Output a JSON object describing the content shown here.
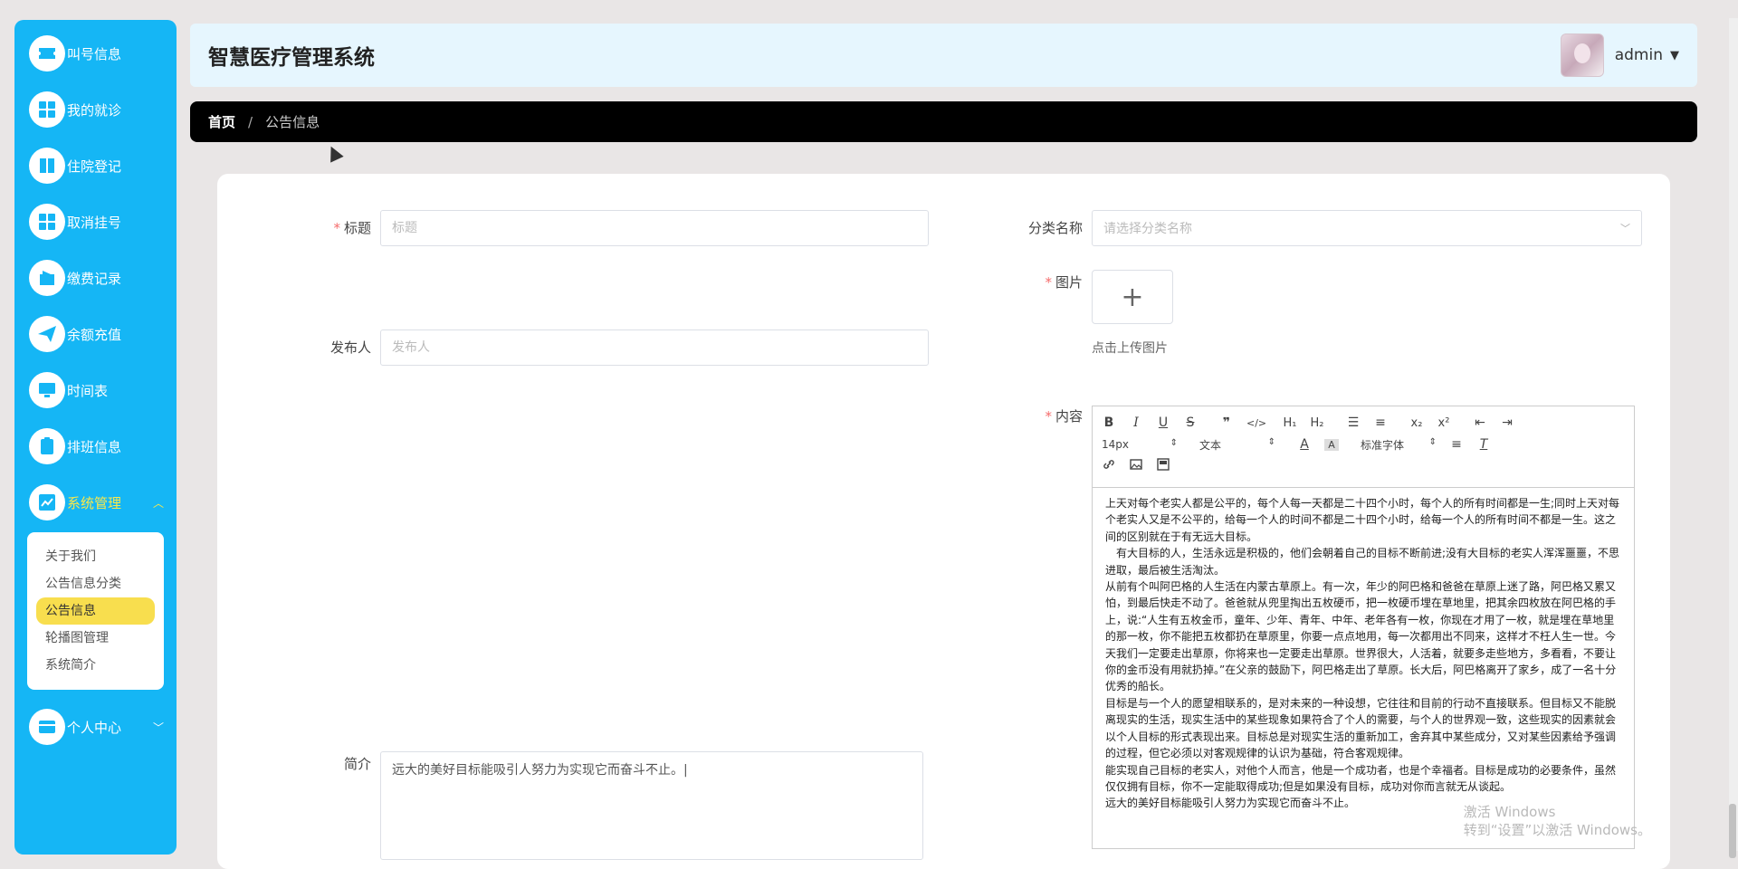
{
  "header": {
    "title": "智慧医疗管理系统",
    "username": "admin"
  },
  "sidebar": {
    "items": [
      {
        "label": "叫号信息",
        "icon": "ticket-icon"
      },
      {
        "label": "我的就诊",
        "icon": "grid-icon"
      },
      {
        "label": "住院登记",
        "icon": "book-icon"
      },
      {
        "label": "取消挂号",
        "icon": "grid-icon"
      },
      {
        "label": "缴费记录",
        "icon": "wallet-icon"
      },
      {
        "label": "余额充值",
        "icon": "paper-plane-icon"
      },
      {
        "label": "时间表",
        "icon": "monitor-icon"
      },
      {
        "label": "排班信息",
        "icon": "clipboard-icon"
      },
      {
        "label": "系统管理",
        "icon": "chart-icon"
      },
      {
        "label": "个人中心",
        "icon": "card-icon"
      }
    ],
    "submenu": [
      "关于我们",
      "公告信息分类",
      "公告信息",
      "轮播图管理",
      "系统简介"
    ]
  },
  "breadcrumb": {
    "home": "首页",
    "separator": "/",
    "current": "公告信息"
  },
  "form": {
    "title_label": "标题",
    "title_placeholder": "标题",
    "category_label": "分类名称",
    "category_placeholder": "请选择分类名称",
    "image_label": "图片",
    "upload_plus": "+",
    "upload_hint": "点击上传图片",
    "publisher_label": "发布人",
    "publisher_placeholder": "发布人",
    "content_label": "内容",
    "summary_label": "简介",
    "summary_value": "远大的美好目标能吸引人努力为实现它而奋斗不止。|"
  },
  "editor": {
    "font_size": "14px",
    "text_style": "文本",
    "font_family": "标准字体",
    "content": [
      "上天对每个老实人都是公平的，每个人每一天都是二十四个小时，每个人的所有时间都是一生;同时上天对每个老实人又是不公平的，给每一个人的时间不都是二十四个小时，给每一个人的所有时间不都是一生。这之间的区别就在于有无远大目标。",
      "　有大目标的人，生活永远是积极的，他们会朝着自己的目标不断前进;没有大目标的老实人浑浑噩噩，不思进取，最后被生活淘汰。",
      "从前有个叫阿巴格的人生活在内蒙古草原上。有一次，年少的阿巴格和爸爸在草原上迷了路，阿巴格又累又怕，到最后快走不动了。爸爸就从兜里掏出五枚硬币，把一枚硬币埋在草地里，把其余四枚放在阿巴格的手上，说:“人生有五枚金币，童年、少年、青年、中年、老年各有一枚，你现在才用了一枚，就是埋在草地里的那一枚，你不能把五枚都扔在草原里，你要一点点地用，每一次都用出不同来，这样才不枉人生一世。今天我们一定要走出草原，你将来也一定要走出草原。世界很大，人活着，就要多走些地方，多看看，不要让你的金币没有用就扔掉。”在父亲的鼓励下，阿巴格走出了草原。长大后，阿巴格离开了家乡，成了一名十分优秀的船长。",
      "目标是与一个人的愿望相联系的，是对未来的一种设想，它往往和目前的行动不直接联系。但目标又不能脱离现实的生活，现实生活中的某些现象如果符合了个人的需要，与个人的世界观一致，这些现实的因素就会以个人目标的形式表现出来。目标总是对现实生活的重新加工，舍弃其中某些成分，又对某些因素给予强调的过程，但它必须以对客观规律的认识为基础，符合客观规律。",
      "能实现自己目标的老实人，对他个人而言，他是一个成功者，也是个幸福者。目标是成功的必要条件，虽然仅仅拥有目标，你不一定能取得成功;但是如果没有目标，成功对你而言就无从谈起。",
      "远大的美好目标能吸引人努力为实现它而奋斗不止。"
    ]
  },
  "watermark": {
    "line1": "激活 Windows",
    "line2": "转到“设置”以激活 Windows。"
  },
  "colors": {
    "sidebar": "#15b6f5",
    "accent_yellow": "#fbe84a",
    "submenu_active": "#f8de4e",
    "header_bg": "#e6f6fe",
    "breadcrumb_bg": "#000000"
  }
}
